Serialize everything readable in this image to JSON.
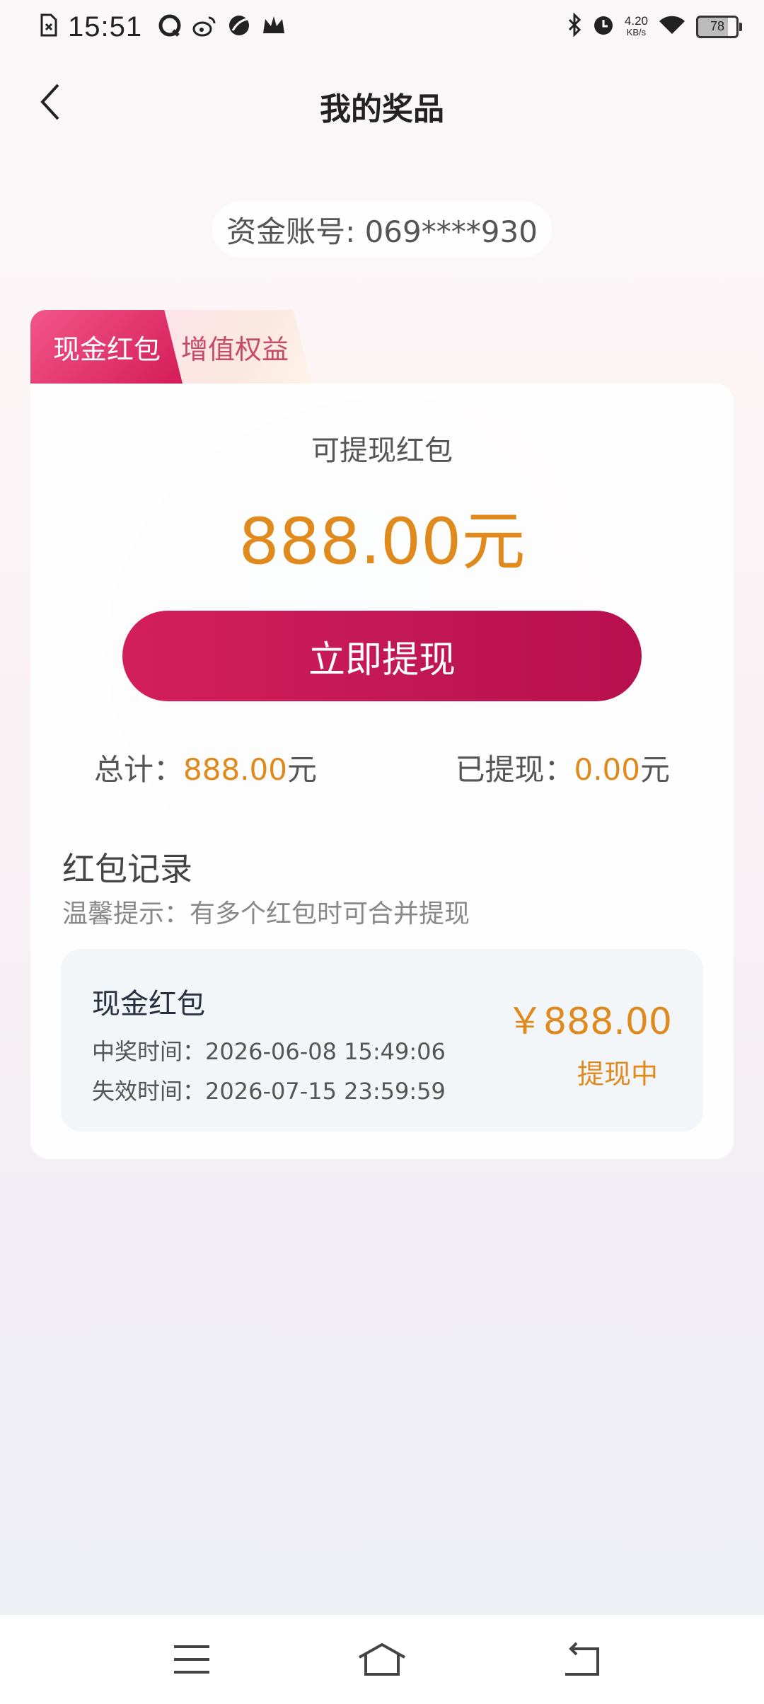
{
  "status_bar": {
    "time": "15:51",
    "net_speed_value": "4.20",
    "net_speed_unit": "KB/s",
    "battery": "78",
    "icons": [
      "sim-error-icon",
      "qq-icon",
      "weibo-icon",
      "leaf-app-icon",
      "crown-icon",
      "bluetooth-icon",
      "alarm-icon",
      "wifi-icon",
      "battery-icon"
    ]
  },
  "header": {
    "title": "我的奖品"
  },
  "account": {
    "label": "资金账号: 069****930"
  },
  "tabs": [
    {
      "label": "现金红包",
      "active": true
    },
    {
      "label": "增值权益",
      "active": false
    }
  ],
  "summary": {
    "available_label": "可提现红包",
    "available_amount": "888.00元",
    "withdraw_button": "立即提现",
    "total_label": "总计：",
    "total_value": "888.00",
    "total_unit": "元",
    "withdrawn_label": "已提现：",
    "withdrawn_value": "0.00",
    "withdrawn_unit": "元"
  },
  "records": {
    "title": "红包记录",
    "tip": "温馨提示：有多个红包时可合并提现",
    "items": [
      {
        "name": "现金红包",
        "win_time": "中奖时间：2026-06-08 15:49:06",
        "expire_time": "失效时间：2026-07-15 23:59:59",
        "amount": "￥888.00",
        "status": "提现中"
      }
    ]
  },
  "colors": {
    "accent": "#d31f5b",
    "amount": "#e08a1e"
  }
}
